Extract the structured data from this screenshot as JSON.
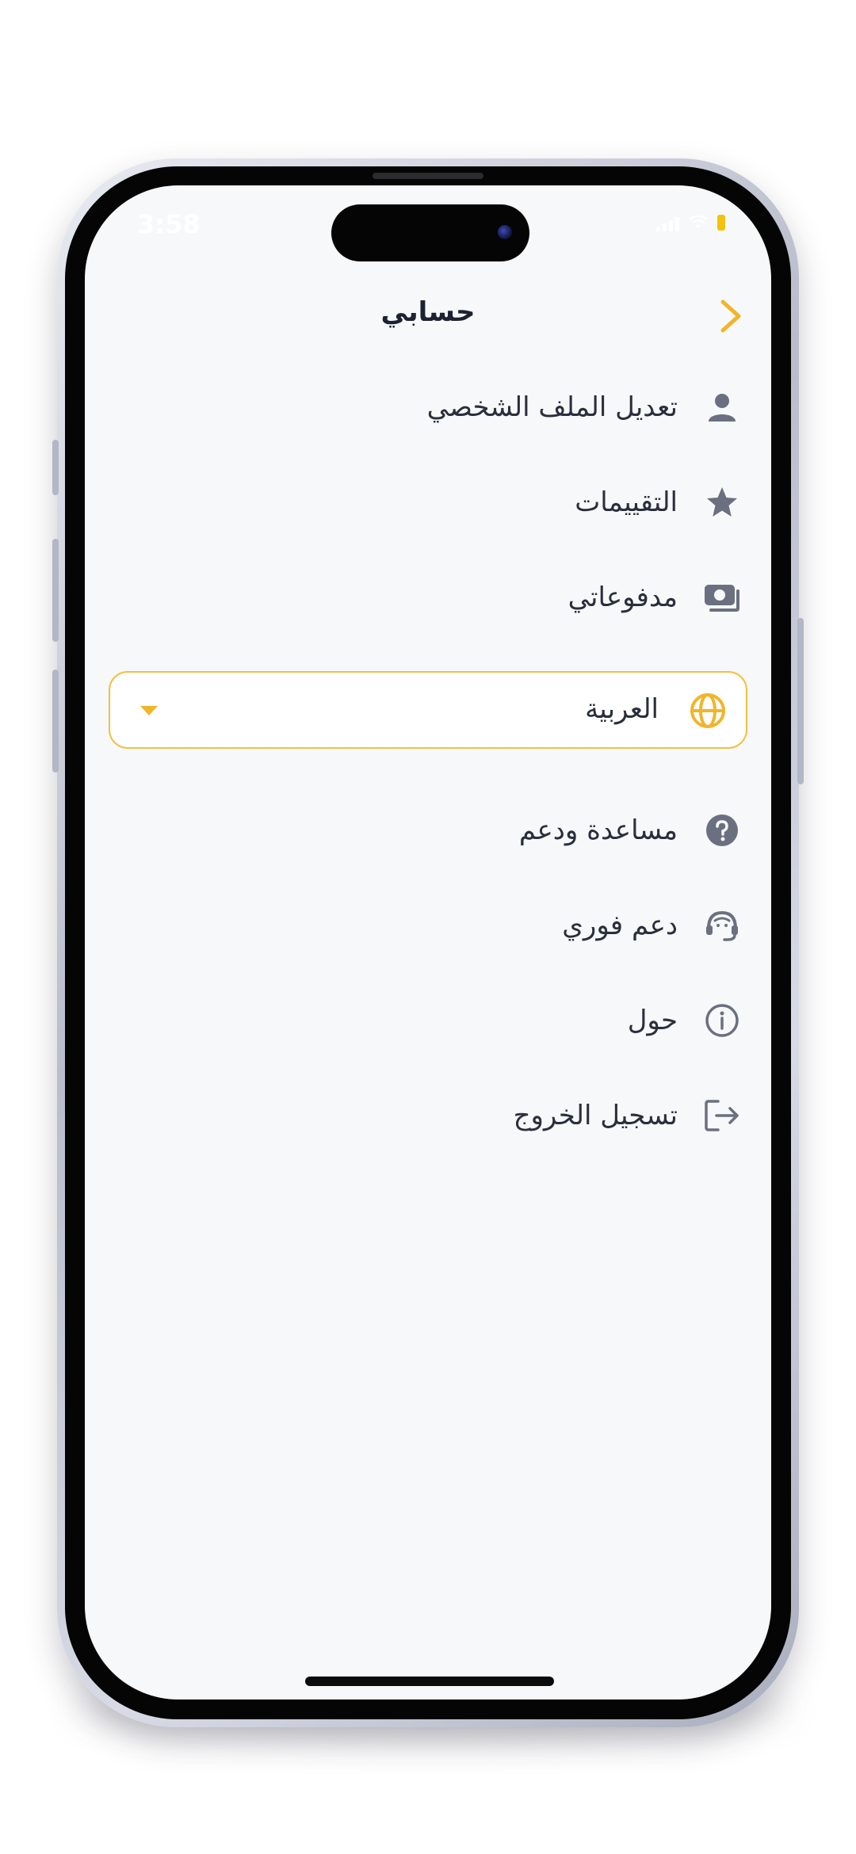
{
  "status_bar": {
    "time": "3:58"
  },
  "header": {
    "title": "حسابي",
    "back_icon": "chevron-right-icon"
  },
  "menu": {
    "items": [
      {
        "label": "تعديل الملف الشخصي",
        "icon": "user-icon"
      },
      {
        "label": "التقييمات",
        "icon": "star-icon"
      },
      {
        "label": "مدفوعاتي",
        "icon": "money-icon"
      },
      {
        "label": "مساعدة ودعم",
        "icon": "question-icon"
      },
      {
        "label": "دعم فوري",
        "icon": "headset-icon"
      },
      {
        "label": "حول",
        "icon": "info-icon"
      },
      {
        "label": "تسجيل الخروج",
        "icon": "logout-icon"
      }
    ]
  },
  "language": {
    "selected": "العربية",
    "icon": "globe-icon"
  },
  "colors": {
    "accent": "#F1B52A",
    "text": "#2A2F3C",
    "icon": "#6B7080",
    "background": "#F7F8FA"
  }
}
